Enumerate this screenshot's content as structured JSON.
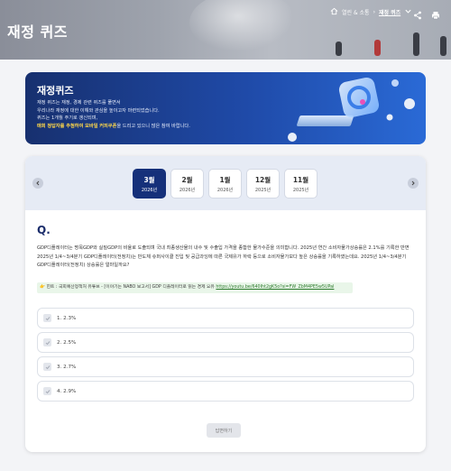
{
  "header": {
    "title": "재정 퀴즈",
    "breadcrumb": [
      "열린 & 소통",
      "재정 퀴즈"
    ],
    "icons": [
      "home-icon",
      "chevron-down-icon",
      "share-icon",
      "print-icon"
    ]
  },
  "banner": {
    "title": "재정퀴즈",
    "line1": "재정 퀴즈는 재정, 경제 관련 퀴즈를 풀면서",
    "line2": "우리나라 재정에 대한 이해와 관심을 높이고자 마련되었습니다.",
    "line3": "퀴즈는 1개월 주기로 갱신되며,",
    "line4_highlight": "매회 정답자를 추첨하여 모바일 커피쿠폰",
    "line4_rest": "을 드리고 있으니 많은 참여 바랍니다."
  },
  "months": [
    {
      "month": "3월",
      "year": "2026년",
      "active": true
    },
    {
      "month": "2월",
      "year": "2026년",
      "active": false
    },
    {
      "month": "1월",
      "year": "2026년",
      "active": false
    },
    {
      "month": "12월",
      "year": "2025년",
      "active": false
    },
    {
      "month": "11월",
      "year": "2025년",
      "active": false
    }
  ],
  "question": {
    "label": "Q.",
    "text": "GDP디플레이터는 명목GDP와 실질GDP의 비율로 도출되며 국내 최종생산물의 내수 및 수출입 가격을 종합한 물가수준을 의미합니다. 2025년 연간 소비자물가상승률은 2.1%를 기록한 반면 2025년 1/4~3/4분기 GDP디플레이터(전정치)는 반도체 슈퍼사이클 진입 및 공급과잉에 따른 국제유가 하락 등으로 소비자물가보다 높은 상승률을 기록하였는데요. 2025년 1/4~3/4분기 GDP디플레이터(전정치) 상승률은 얼마일까요?",
    "reference_prefix": "👉 힌트 : 국회예산정책처 유튜브 - [이야기는 NABO 보고서] GDP 디플레이터로 읽는 경제 요유",
    "reference_link": "https://youtu.be/640Iht2gK5o?si=FW_ZbM4PE5w5UPal"
  },
  "options": [
    "1. 2.3%",
    "2. 2.5%",
    "3. 2.7%",
    "4. 2.9%"
  ],
  "submit_label": "답변하기",
  "colors": {
    "primary": "#15307a",
    "banner_start": "#17306f",
    "banner_end": "#2a6ad6",
    "highlight": "#ffd84a"
  }
}
